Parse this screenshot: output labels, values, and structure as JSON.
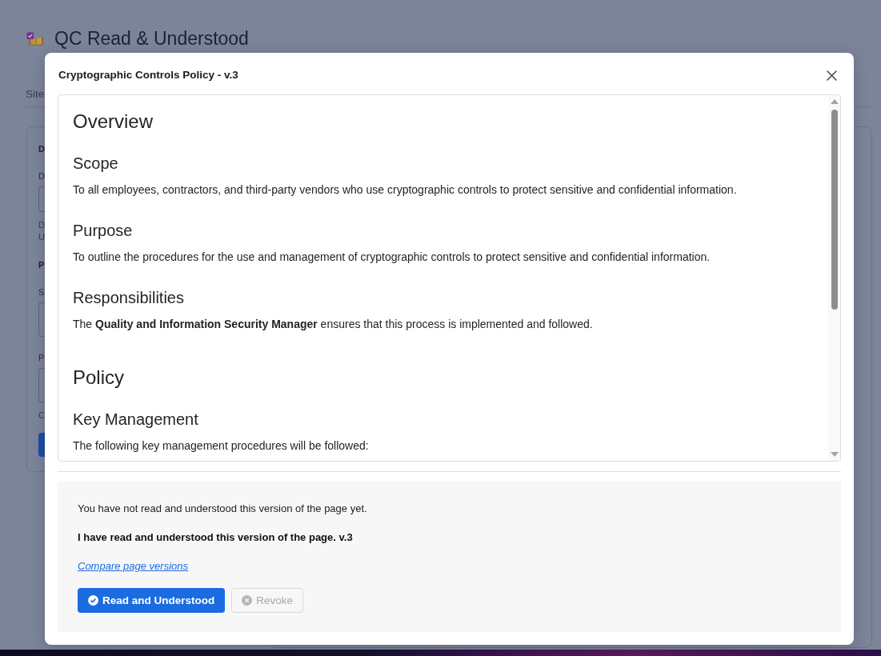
{
  "background_page": {
    "title": "QC Read & Understood",
    "subnav_label": "Site",
    "form_card": {
      "items": [
        {
          "kind": "heading",
          "text": "D"
        },
        {
          "kind": "label",
          "text": "D"
        },
        {
          "kind": "input"
        },
        {
          "kind": "hint",
          "text": "D"
        },
        {
          "kind": "hint",
          "text": "U"
        },
        {
          "kind": "heading",
          "text": "P"
        },
        {
          "kind": "label",
          "text": "S"
        },
        {
          "kind": "textarea"
        },
        {
          "kind": "label",
          "text": "P"
        },
        {
          "kind": "textarea"
        },
        {
          "kind": "hint",
          "text": "C"
        },
        {
          "kind": "button"
        }
      ]
    }
  },
  "dialog": {
    "title": "Cryptographic Controls Policy - v.3",
    "document": [
      {
        "kind": "h1",
        "text": "Overview"
      },
      {
        "kind": "h2",
        "text": "Scope"
      },
      {
        "kind": "p",
        "text": "To all employees, contractors, and third-party vendors who use cryptographic controls to protect sensitive and confidential information."
      },
      {
        "kind": "h2",
        "text": "Purpose"
      },
      {
        "kind": "p",
        "text": "To outline the procedures for the use and management of cryptographic controls to protect sensitive and confidential information."
      },
      {
        "kind": "h2",
        "text": "Responsibilities"
      },
      {
        "kind": "p",
        "text": "The **Quality and Information Security Manager** ensures that this process is implemented and followed."
      },
      {
        "kind": "h1",
        "text": "Policy"
      },
      {
        "kind": "h2",
        "text": "Key Management"
      },
      {
        "kind": "p",
        "text": "The following key management procedures will be followed:"
      }
    ],
    "acknowledgement": {
      "status": "You have not read and understood this version of the page yet.",
      "statement": "I have read and understood this version of the page. v.3",
      "compare_link": "Compare page versions",
      "buttons": [
        {
          "kind": "confirm",
          "label": "Read and Understood",
          "disabled": false
        },
        {
          "kind": "revoke",
          "label": "Revoke",
          "disabled": true
        }
      ]
    }
  }
}
